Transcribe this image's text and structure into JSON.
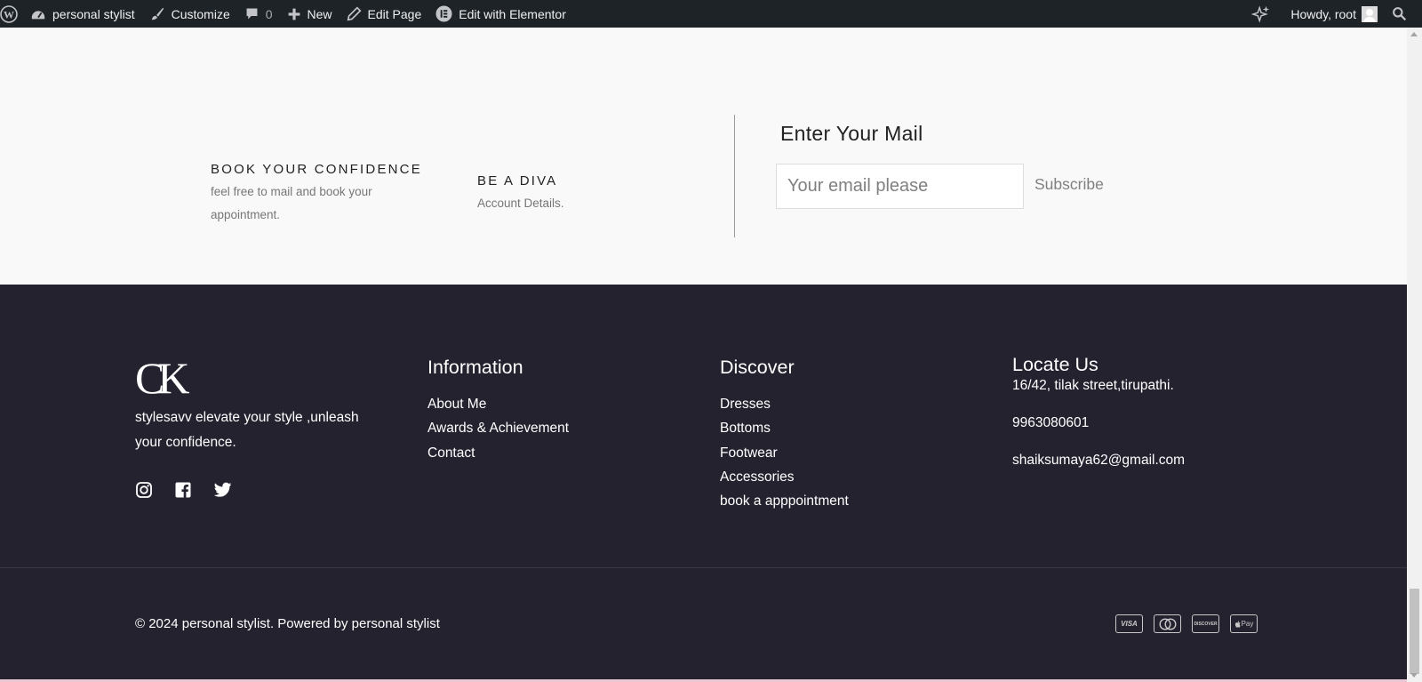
{
  "admin_bar": {
    "site_name": "personal stylist",
    "customize": "Customize",
    "comments_count": "0",
    "new": "New",
    "edit_page": "Edit Page",
    "edit_elementor": "Edit with Elementor",
    "howdy": "Howdy, root"
  },
  "newsletter": {
    "col1": {
      "heading": "BOOK YOUR CONFIDENCE",
      "line1": "feel free to mail and book your",
      "line2": "appointment."
    },
    "col2": {
      "heading": "BE A DIVA",
      "text": "Account Details."
    },
    "mail_title": "Enter Your Mail",
    "email_placeholder": "Your email please",
    "subscribe": "Subscribe"
  },
  "footer": {
    "brand": {
      "logo": "CK",
      "tagline_line1": "stylesavv elevate your style ,unleash",
      "tagline_line2": "your confidence.",
      "social_icons": [
        "instagram-icon",
        "facebook-icon",
        "twitter-icon"
      ]
    },
    "information": {
      "title": "Information",
      "links": [
        "About Me",
        "Awards & Achievement",
        "Contact"
      ]
    },
    "discover": {
      "title": "Discover",
      "links": [
        "Dresses",
        "Bottoms",
        "Footwear",
        "Accessories",
        "book a apppointment"
      ]
    },
    "locate": {
      "title": "Locate Us",
      "address": "16/42, tilak street,tirupathi.",
      "phone": "9963080601",
      "email": "shaiksumaya62@gmail.com"
    },
    "copyright": "© 2024 personal stylist. Powered by personal stylist",
    "payments": [
      "VISA",
      "DISCOVER",
      "Pay"
    ]
  },
  "colors": {
    "admin_bar": "#1d2327",
    "footer_bg": "#25222f",
    "page_bg": "#f9f9f9"
  }
}
